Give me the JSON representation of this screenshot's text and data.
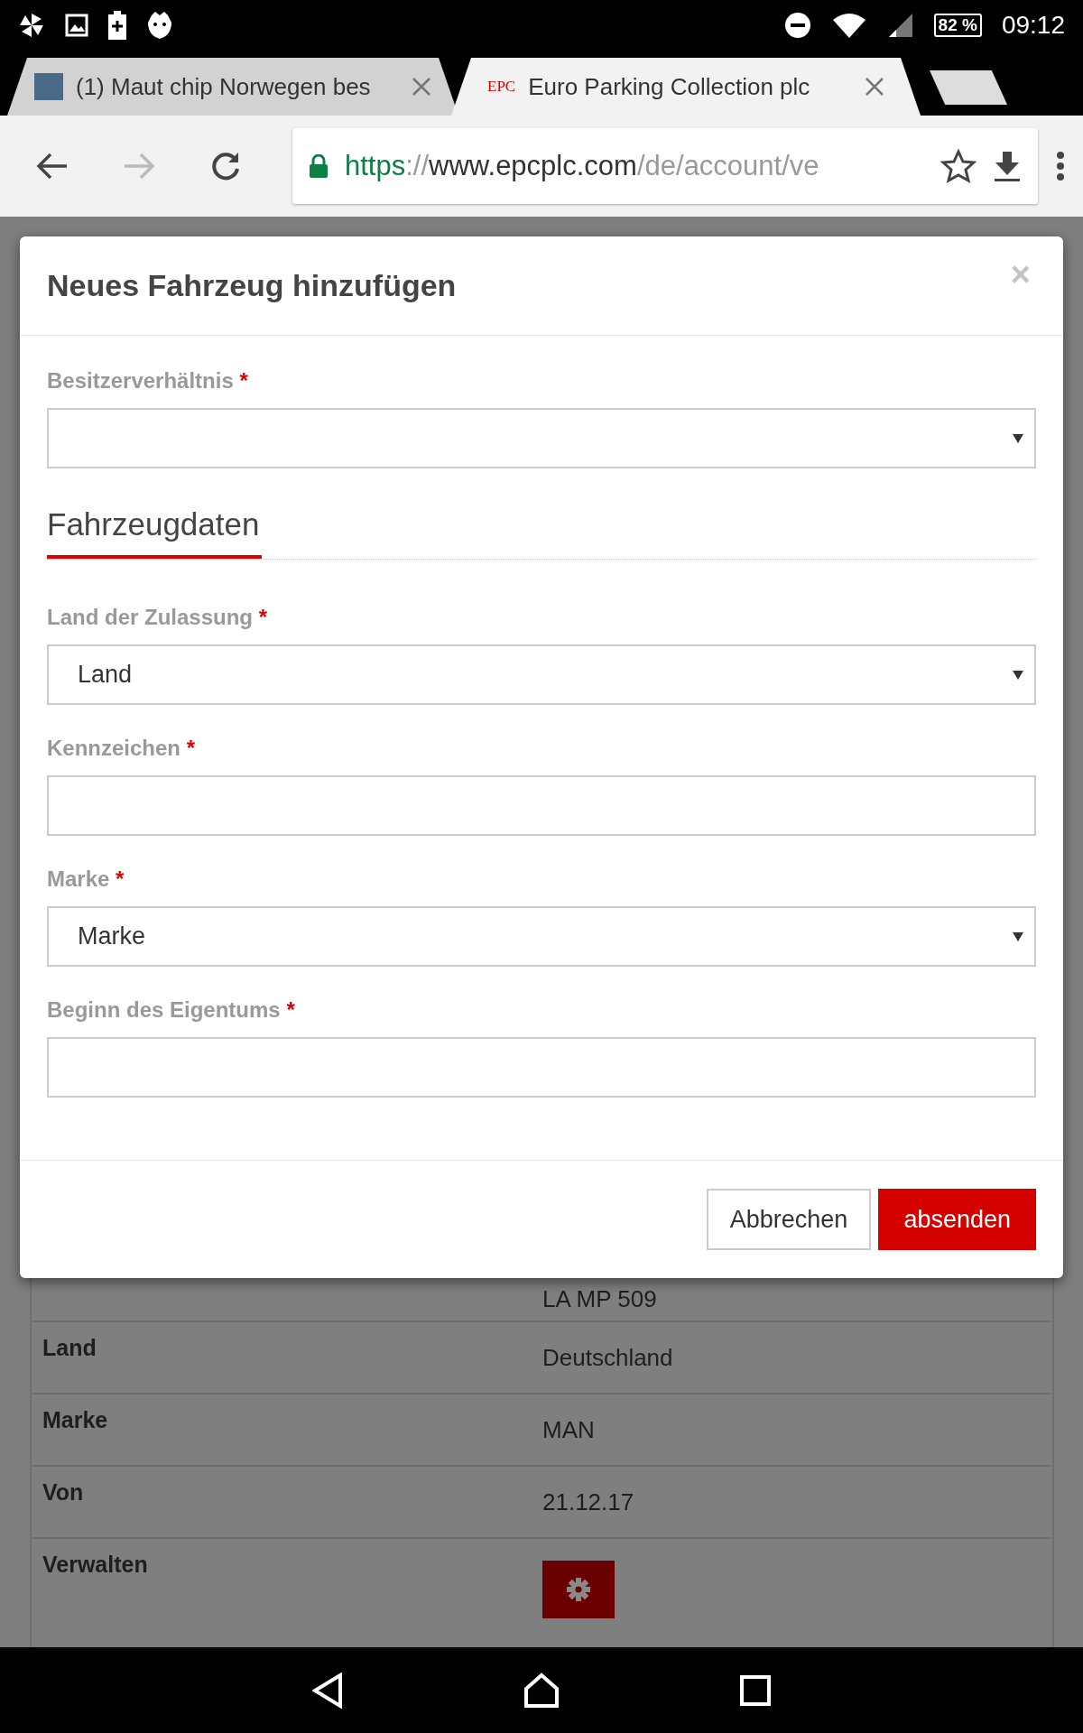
{
  "status_bar": {
    "battery": "82 %",
    "time": "09:12"
  },
  "tabs": [
    {
      "title": "(1) Maut chip Norwegen bes",
      "kind": "photo",
      "selected": false
    },
    {
      "title": "Euro Parking Collection plc",
      "kind": "logo",
      "logo": "EPC",
      "selected": true
    }
  ],
  "toolbar": {
    "url": {
      "scheme": "https",
      "separator": "://",
      "host": "www.epcplc.com",
      "path": "/de/account/ve"
    }
  },
  "dialog": {
    "title": "Neues Fahrzeug hinzufügen",
    "close": "×",
    "fields": [
      {
        "kind": "select",
        "label": "Besitzerverhältnis",
        "marker": "*"
      },
      {
        "kind": "section",
        "label": "Fahrzeugdaten"
      },
      {
        "kind": "select",
        "label": "Land der Zulassung",
        "marker": "*",
        "value": "Land"
      },
      {
        "kind": "text",
        "label": "Kennzeichen",
        "marker": "*"
      },
      {
        "kind": "select",
        "label": "Marke",
        "marker": "*",
        "value": "Marke"
      },
      {
        "kind": "text",
        "label": "Beginn des Eigentums",
        "marker": "*"
      }
    ],
    "buttons": [
      {
        "label": "Abbrechen",
        "kind": "secondary"
      },
      {
        "label": "absenden",
        "kind": "primary"
      }
    ]
  },
  "vehicle_table": {
    "rows": [
      {
        "value": "LA MP 509",
        "kind": "text"
      },
      {
        "label": "Land",
        "value": "Deutschland",
        "kind": "text"
      },
      {
        "label": "Marke",
        "value": "MAN",
        "kind": "text"
      },
      {
        "label": "Von",
        "value": "21.12.17",
        "kind": "text"
      },
      {
        "label": "Verwalten",
        "kind": "action"
      }
    ]
  }
}
